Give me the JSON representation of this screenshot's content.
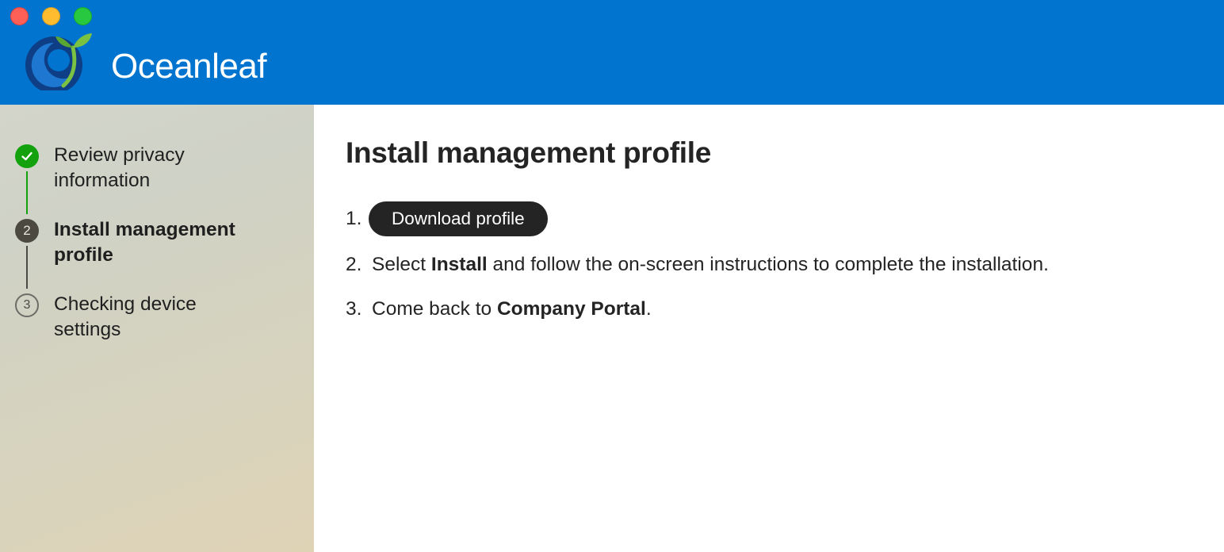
{
  "window": {
    "controls": [
      "close",
      "minimize",
      "zoom"
    ],
    "colors": {
      "header_bg": "#0074cf",
      "step_done": "#13a10e",
      "step_current": "#4c4a40",
      "button_bg": "#242424"
    }
  },
  "header": {
    "logo_icon": "oceanleaf-logo-icon",
    "brand_name": "Oceanleaf"
  },
  "sidebar": {
    "steps": [
      {
        "number": "1",
        "label_line1": "Review privacy",
        "label_line2": "information",
        "state": "complete",
        "icon": "checkmark-icon"
      },
      {
        "number": "2",
        "label_line1": "Install management",
        "label_line2": "profile",
        "state": "current"
      },
      {
        "number": "3",
        "label_line1": "Checking device",
        "label_line2": "settings",
        "state": "pending"
      }
    ]
  },
  "main": {
    "title": "Install management profile",
    "instructions": [
      {
        "number": "1.",
        "button_label": "Download profile"
      },
      {
        "number": "2.",
        "text_before": "Select ",
        "bold": "Install",
        "text_after": " and follow the on-screen instructions to complete the installation."
      },
      {
        "number": "3.",
        "text_before": "Come back to ",
        "bold": "Company Portal",
        "text_after": "."
      }
    ]
  }
}
